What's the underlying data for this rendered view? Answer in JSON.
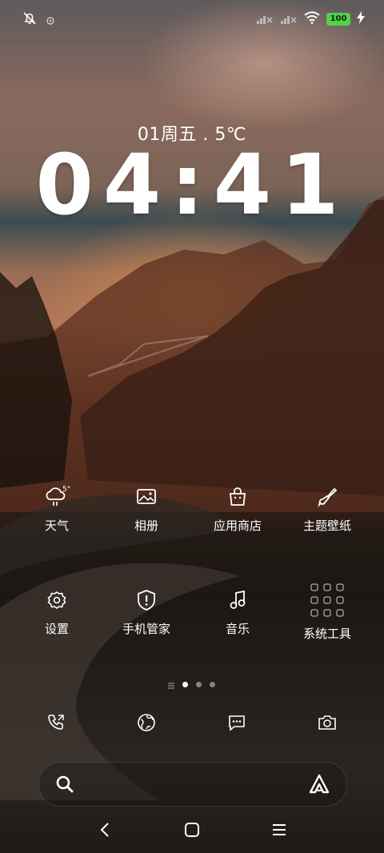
{
  "status_bar": {
    "battery": "100",
    "icons": [
      "bell-off-icon",
      "small-status-icon",
      "signal-no-sim-icon",
      "signal-no-sim-icon",
      "wifi-icon",
      "battery-icon",
      "charging-icon"
    ]
  },
  "lock": {
    "date_weather": "01周五 . 5℃",
    "time": "04:41"
  },
  "apps": [
    {
      "label": "天气",
      "icon": "weather-icon",
      "badge": "5°"
    },
    {
      "label": "相册",
      "icon": "gallery-icon"
    },
    {
      "label": "应用商店",
      "icon": "app-store-icon"
    },
    {
      "label": "主题壁纸",
      "icon": "theme-brush-icon"
    },
    {
      "label": "设置",
      "icon": "settings-gear-icon"
    },
    {
      "label": "手机管家",
      "icon": "security-shield-icon"
    },
    {
      "label": "音乐",
      "icon": "music-note-icon"
    },
    {
      "label": "系统工具",
      "icon": "system-tools-folder-icon"
    }
  ],
  "page_indicator": {
    "pages": 3,
    "active": 0
  },
  "dock": [
    "phone-icon",
    "browser-icon",
    "messages-icon",
    "camera-icon"
  ],
  "search": {
    "icons": [
      "search-icon",
      "assistant-icon"
    ]
  },
  "nav": [
    "back-icon",
    "home-icon",
    "menu-icon"
  ]
}
